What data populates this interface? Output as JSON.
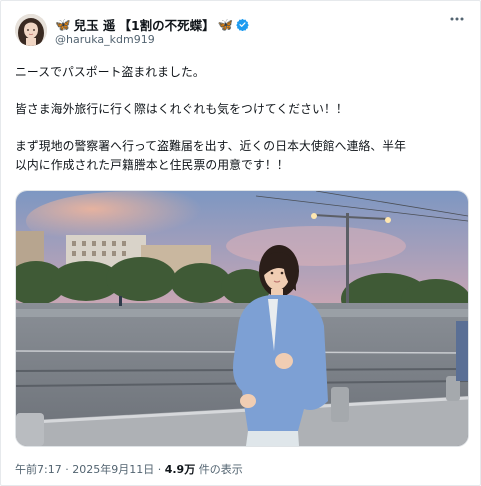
{
  "author": {
    "prefix_emoji": "🦋",
    "name": "兒玉 遥",
    "tag": "【1割の不死蝶】",
    "suffix_emoji": "🦋",
    "handle": "@haruka_kdm919",
    "verified_color": "#1d9bf0"
  },
  "tweet": {
    "line1": "ニースでパスポート盗まれました。",
    "line2": "皆さま海外旅行に行く際はくれぐれも気をつけてください！！",
    "line3": "まず現地の警察署へ行って盗難届を出す、近くの日本大使館へ連絡、半年",
    "line4": "以内に作成された戸籍謄本と住民票の用意です！！"
  },
  "meta": {
    "time": "午前7:17",
    "date": "2025年9月11日",
    "views": "4.9万",
    "views_suffix": "件の表示",
    "separator": "·"
  },
  "colors": {
    "text": "#0f1419",
    "subtext": "#536471",
    "border": "#e6e9ec"
  }
}
